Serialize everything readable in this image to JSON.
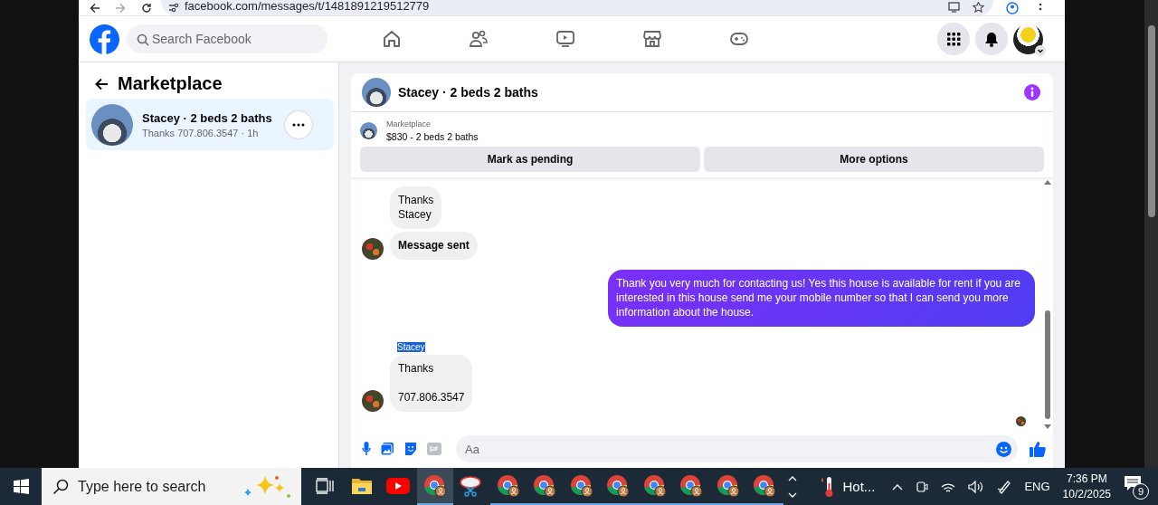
{
  "browser": {
    "url": "facebook.com/messages/t/1481891219512779"
  },
  "header": {
    "search_placeholder": "Search Facebook"
  },
  "sidebar": {
    "title": "Marketplace",
    "conversations": [
      {
        "title": "Stacey · 2 beds 2 baths",
        "preview": "Thanks 707.806.3547 · 1h",
        "selected": true
      }
    ]
  },
  "chat": {
    "title": "Stacey · 2 beds 2 baths",
    "listing": {
      "label": "Marketplace",
      "title": "$830 - 2 beds 2 baths"
    },
    "actions": [
      "Mark as pending",
      "More options"
    ],
    "messages": [
      {
        "kind": "incoming",
        "paragraphs": [
          "Thanks\nStacey"
        ],
        "bold": false,
        "avatar": false
      },
      {
        "kind": "incoming",
        "paragraphs": [
          "Message sent"
        ],
        "bold": true,
        "avatar": true
      },
      {
        "kind": "outgoing",
        "paragraphs": [
          "Thank you very much for contacting us! Yes this house is available for rent if you are interested in this house send me your mobile number so that I can send you more information about the house."
        ],
        "bold": false
      },
      {
        "kind": "sender",
        "text": "Stacey",
        "highlighted": true
      },
      {
        "kind": "incoming",
        "paragraphs": [
          "Thanks",
          "707.806.3547"
        ],
        "bold": false,
        "avatar": true
      }
    ],
    "composer": {
      "placeholder": "Aa"
    }
  },
  "taskbar": {
    "search_placeholder": "Type here to search",
    "apps": [
      {
        "kind": "taskview",
        "selected": false
      },
      {
        "kind": "folder",
        "selected": false
      },
      {
        "kind": "youtube",
        "selected": false
      },
      {
        "kind": "chrome",
        "selected": true
      },
      {
        "kind": "snip",
        "selected": false
      },
      {
        "kind": "chrome",
        "selected": false
      },
      {
        "kind": "chrome",
        "selected": false
      },
      {
        "kind": "chrome",
        "selected": false
      },
      {
        "kind": "chrome",
        "selected": false
      },
      {
        "kind": "chrome",
        "selected": false
      },
      {
        "kind": "chrome",
        "selected": false
      },
      {
        "kind": "chrome",
        "selected": false
      },
      {
        "kind": "chrome",
        "selected": false
      }
    ],
    "weather": "Hot...",
    "language": "ENG",
    "time": "7:36 PM",
    "date": "10/2/2025",
    "notifications": "9"
  }
}
